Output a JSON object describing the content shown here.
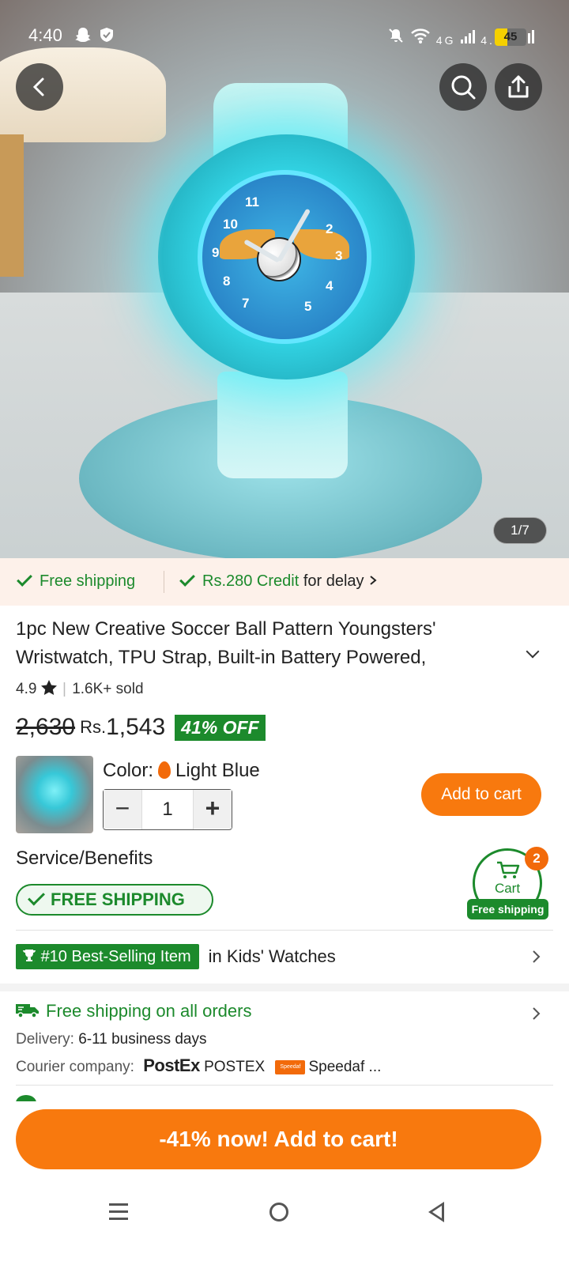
{
  "status_bar": {
    "time": "4:40",
    "left_icons": [
      "snapchat-icon",
      "shield-icon"
    ],
    "right_icons": [
      "mute-icon",
      "wifi-icon",
      "4g-signal-icon",
      "4.5g-signal-icon"
    ],
    "network_1": "4G",
    "network_2": "4.5G",
    "battery": "45"
  },
  "gallery": {
    "counter": "1/7",
    "numerals": [
      "11",
      "10",
      "9",
      "8",
      "7",
      "5",
      "4",
      "3",
      "2"
    ]
  },
  "promo": {
    "free_shipping": "Free shipping",
    "credit": "Rs.280 Credit",
    "credit_suffix": "for delay"
  },
  "product": {
    "title": "1pc New Creative Soccer Ball Pattern Youngsters' Wristwatch, TPU Strap, Built-in Battery Powered,",
    "rating": "4.9",
    "sold": "1.6K+ sold",
    "old_price": "2,630",
    "currency": "Rs.",
    "price": "1,543",
    "discount": "41% OFF"
  },
  "variant": {
    "color_label": "Color:",
    "color_value": "Light Blue",
    "quantity": "1",
    "minus": "−",
    "plus": "+",
    "add_to_cart": "Add to cart"
  },
  "service": {
    "title": "Service/Benefits",
    "free_shipping_badge": "FREE SHIPPING"
  },
  "cart_float": {
    "label": "Cart",
    "count": "2",
    "tag": "Free shipping"
  },
  "best_seller": {
    "badge": "#10 Best-Selling Item",
    "category": "in Kids' Watches"
  },
  "shipping": {
    "title": "Free shipping on all orders",
    "delivery_label": "Delivery:",
    "delivery_value": "6-11 business days",
    "courier_label": "Courier company:",
    "courier_logo": "PostEx",
    "courier_1": "POSTEX",
    "courier_2_logo": "Speedaf express",
    "courier_2": "Speedaf ..."
  },
  "cta": {
    "label": "-41% now! Add to cart!"
  },
  "colors": {
    "accent_orange": "#f8790e",
    "success_green": "#1c8a2c",
    "promo_bg": "#fdf1ea"
  }
}
